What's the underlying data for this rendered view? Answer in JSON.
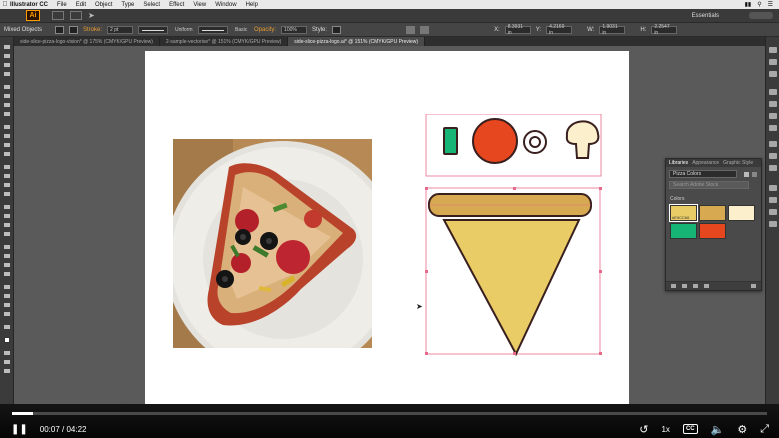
{
  "menubar": {
    "app_name": "Illustrator CC",
    "items": [
      "File",
      "Edit",
      "Object",
      "Type",
      "Select",
      "Effect",
      "View",
      "Window",
      "Help"
    ]
  },
  "appbar": {
    "logo": "Ai",
    "workspace": "Essentials"
  },
  "controlbar": {
    "selection_label": "Mixed Objects",
    "stroke_label": "Stroke:",
    "stroke_value": "2 pt",
    "profile_value": "Uniform",
    "brush_value": "Basic",
    "opacity_label": "Opacity:",
    "opacity_value": "100%",
    "style_label": "Style:",
    "x_value": "8.3931 in",
    "y_value": "4.2169 in",
    "w_value": "1.9031 in",
    "h_value": "2.2547 in"
  },
  "tabs": [
    {
      "label": "side-slice-pizza-logo-vision* @ 175% (CMYK/GPU Preview)",
      "active": false
    },
    {
      "label": "2-sample-vectorise* @ 151% (CMYK/GPU Preview)",
      "active": false
    },
    {
      "label": "side-slice-pizza-logo.ai* @ 151% (CMYK/GPU Preview)",
      "active": true
    }
  ],
  "libraries_panel": {
    "tabs": [
      "Libraries",
      "Appearance",
      "Graphic Style"
    ],
    "library_name": "Pizza Colors",
    "search_placeholder": "Search Adobe Stock",
    "section_title": "Colors",
    "swatches": [
      {
        "color": "#e9cc66",
        "label": "#E9CC66",
        "selected": true
      },
      {
        "color": "#d7aa52",
        "label": "",
        "selected": false
      },
      {
        "color": "#fbf0cb",
        "label": "",
        "selected": false
      },
      {
        "color": "#17b575",
        "label": "",
        "selected": false
      },
      {
        "color": "#e6471f",
        "label": "",
        "selected": false
      }
    ]
  },
  "artwork": {
    "colors": {
      "crust": "#d7aa52",
      "cheese": "#e9cc66",
      "pepperoni": "#e6471f",
      "green_pepper": "#17b575",
      "mushroom": "#fbf0cb",
      "outline": "#3a1f1f",
      "selection": "#e86a8a"
    }
  },
  "player": {
    "current_time": "00:07",
    "separator": " / ",
    "duration": "04:22",
    "progress": 0.028,
    "speed": "1x",
    "cc_label": "CC"
  }
}
